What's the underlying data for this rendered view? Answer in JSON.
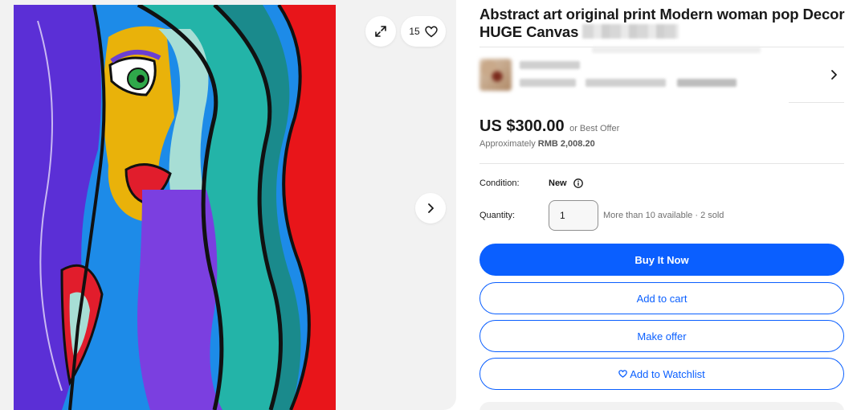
{
  "gallery": {
    "photo_count": "15"
  },
  "listing": {
    "title": "Abstract art original print Modern woman pop Decor HUGE Canvas"
  },
  "pricing": {
    "price": "US $300.00",
    "best_offer": "or Best Offer",
    "approx_prefix": "Approximately ",
    "approx_value": "RMB 2,008.20"
  },
  "details": {
    "condition_label": "Condition:",
    "condition_value": "New",
    "quantity_label": "Quantity:",
    "quantity_value": "1",
    "availability": "More than 10 available · 2 sold"
  },
  "actions": {
    "buy_now": "Buy It Now",
    "add_to_cart": "Add to cart",
    "make_offer": "Make offer",
    "watchlist": "Add to Watchlist"
  },
  "colors": {
    "accent": "#0a5fff",
    "muted_text": "#707070",
    "gallery_bg": "#f2f2f2"
  },
  "icons": [
    "expand-icon",
    "heart-icon",
    "chevron-right-icon",
    "info-icon"
  ]
}
